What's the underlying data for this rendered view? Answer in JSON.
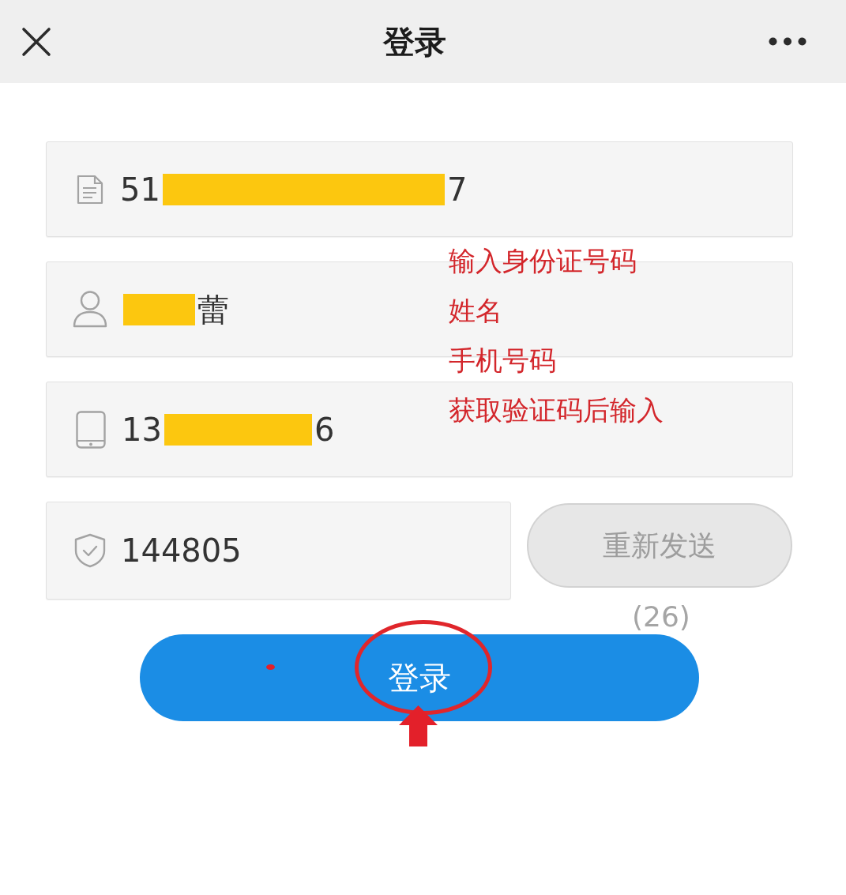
{
  "header": {
    "title": "登录"
  },
  "fields": [
    {
      "kind": "id",
      "value_parts": [
        {
          "kind": "text",
          "text": "51"
        },
        {
          "kind": "redaction"
        },
        {
          "kind": "text",
          "text": "7"
        }
      ]
    },
    {
      "kind": "user",
      "value_parts": [
        {
          "kind": "redaction"
        },
        {
          "kind": "text",
          "text": "蕾"
        }
      ]
    },
    {
      "kind": "phone",
      "value_parts": [
        {
          "kind": "text",
          "text": "13"
        },
        {
          "kind": "redaction"
        },
        {
          "kind": "text",
          "text": "6"
        }
      ]
    },
    {
      "kind": "code",
      "value_parts": [
        {
          "kind": "text",
          "text": "144805"
        }
      ]
    }
  ],
  "resend_button": {
    "label": "重新发送",
    "disabled": true
  },
  "countdown": "(26)",
  "login_button": {
    "label": "登录"
  },
  "annotation_notes": [
    "输入身份证号码",
    "姓名",
    "手机号码",
    "获取验证码后输入"
  ]
}
